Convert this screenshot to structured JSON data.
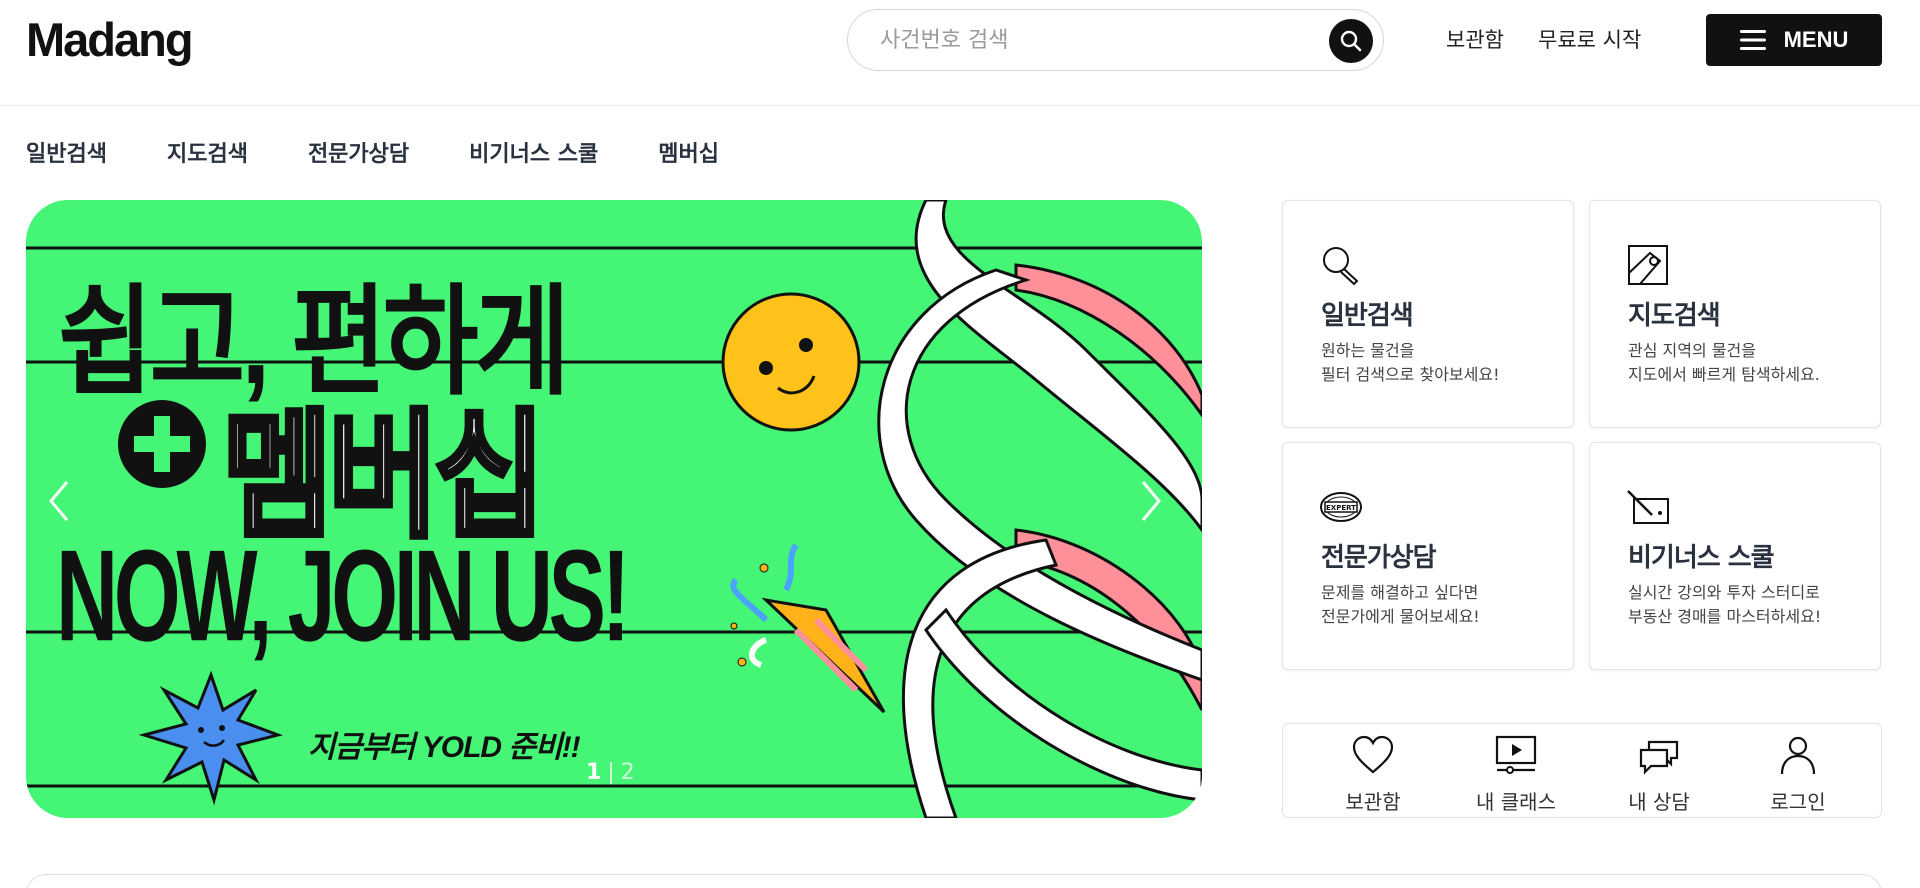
{
  "header": {
    "logo": "Madang",
    "search_placeholder": "사건번호 검색",
    "links": [
      "보관함",
      "무료로 시작"
    ],
    "menu_label": "MENU"
  },
  "nav": {
    "items": [
      "일반검색",
      "지도검색",
      "전문가상담",
      "비기너스 스쿨",
      "멤버십"
    ]
  },
  "banner": {
    "headline1": "쉽고, 편하게",
    "headline2": "멤버십",
    "headline3": "NOW, JOIN US!",
    "tagline": "지금부터 YOLD 준비!!",
    "pager_current": "1",
    "pager_separator": "|",
    "pager_total": "2",
    "background_color": "#45f575"
  },
  "cards": [
    {
      "icon": "magnifier-icon",
      "title": "일반검색",
      "line1": "원하는 물건을",
      "line2": "필터 검색으로 찾아보세요!"
    },
    {
      "icon": "map-icon",
      "title": "지도검색",
      "line1": "관심 지역의 물건을",
      "line2": "지도에서 빠르게 탐색하세요."
    },
    {
      "icon": "expert-badge-icon",
      "title": "전문가상담",
      "line1": "문제를 해결하고 싶다면",
      "line2": "전문가에게 물어보세요!"
    },
    {
      "icon": "drawing-board-icon",
      "title": "비기너스 스쿨",
      "line1": "실시간 강의와 투자 스터디로",
      "line2": "부동산 경매를 마스터하세요!"
    }
  ],
  "quick": [
    {
      "icon": "heart-icon",
      "label": "보관함"
    },
    {
      "icon": "video-class-icon",
      "label": "내 클래스"
    },
    {
      "icon": "chat-bubbles-icon",
      "label": "내 상담"
    },
    {
      "icon": "user-icon",
      "label": "로그인"
    }
  ]
}
